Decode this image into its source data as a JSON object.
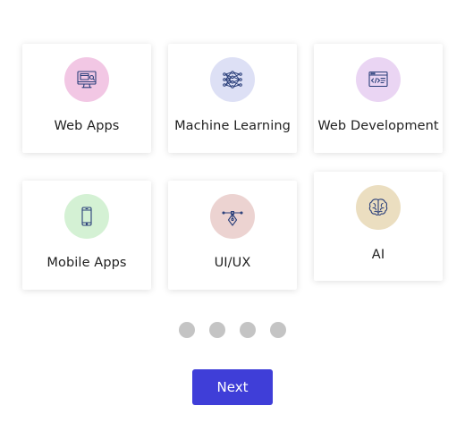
{
  "cards": [
    {
      "label": "Web Apps",
      "icon": "web-monitor-icon",
      "circle_color": "#f2c7e4"
    },
    {
      "label": "Machine Learning",
      "icon": "neural-network-icon",
      "circle_color": "#dde0f5"
    },
    {
      "label": "Web Development",
      "icon": "code-window-icon",
      "circle_color": "#ead5f3"
    },
    {
      "label": "Mobile Apps",
      "icon": "smartphone-icon",
      "circle_color": "#d4f1d4"
    },
    {
      "label": "UI/UX",
      "icon": "design-pen-icon",
      "circle_color": "#ecd3d1"
    },
    {
      "label": "AI",
      "icon": "brain-icon",
      "circle_color": "#ebdec0"
    }
  ],
  "pagination": {
    "count": 4,
    "dot_color": "#c4c4c4"
  },
  "next_button": {
    "label": "Next",
    "color": "#3f3ed8"
  },
  "icon_stroke": "#2a3f7a"
}
